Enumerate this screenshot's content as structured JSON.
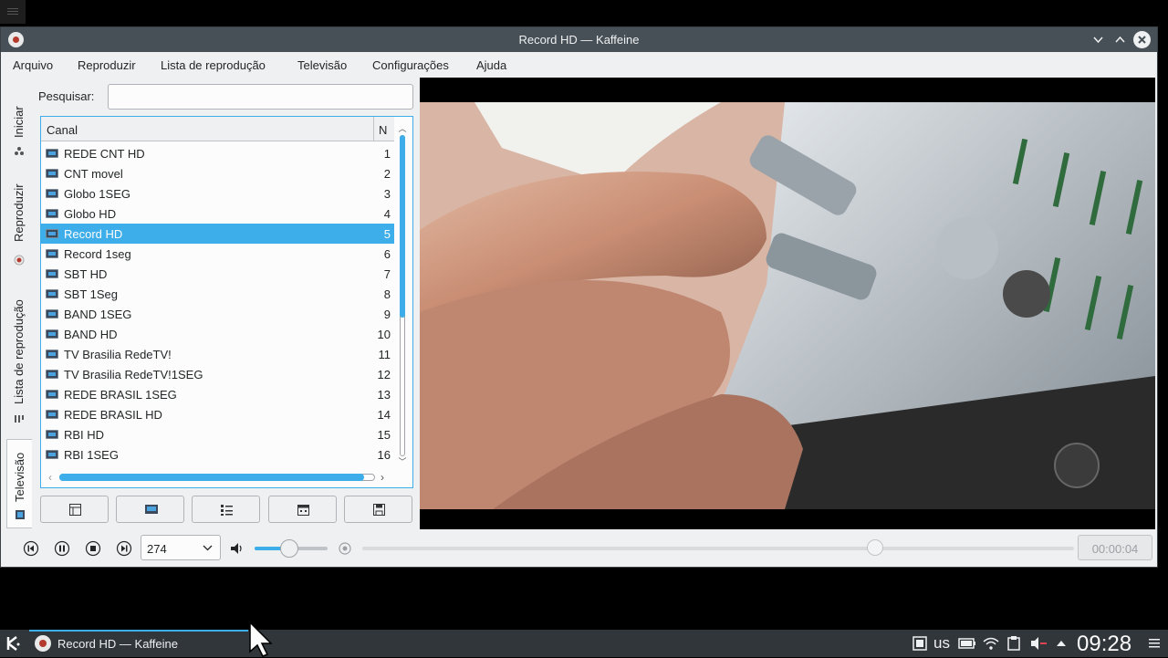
{
  "window": {
    "title": "Record HD — Kaffeine"
  },
  "menu": [
    "Arquivo",
    "Reproduzir",
    "Lista de reprodução",
    "Televisão",
    "Configurações",
    "Ajuda"
  ],
  "side_tabs": [
    "Iniciar",
    "Reproduzir",
    "Lista de reprodução",
    "Televisão"
  ],
  "search": {
    "label": "Pesquisar:",
    "value": ""
  },
  "channel_list": {
    "header_channel": "Canal",
    "header_number": "N",
    "rows": [
      {
        "name": "REDE CNT HD",
        "number": "1"
      },
      {
        "name": "CNT movel",
        "number": "2"
      },
      {
        "name": "Globo 1SEG",
        "number": "3"
      },
      {
        "name": "Globo HD",
        "number": "4"
      },
      {
        "name": "Record HD",
        "number": "5"
      },
      {
        "name": "Record 1seg",
        "number": "6"
      },
      {
        "name": "SBT HD",
        "number": "7"
      },
      {
        "name": "SBT 1Seg",
        "number": "8"
      },
      {
        "name": "BAND 1SEG",
        "number": "9"
      },
      {
        "name": "BAND HD",
        "number": "10"
      },
      {
        "name": "TV Brasilia RedeTV!",
        "number": "11"
      },
      {
        "name": "TV Brasilia RedeTV!1SEG",
        "number": "12"
      },
      {
        "name": "REDE BRASIL 1SEG",
        "number": "13"
      },
      {
        "name": "REDE BRASIL HD",
        "number": "14"
      },
      {
        "name": "RBI HD",
        "number": "15"
      },
      {
        "name": "RBI 1SEG",
        "number": "16"
      }
    ],
    "selected_index": 4
  },
  "transport": {
    "channel_value": "274",
    "volume_level": 0.47,
    "seek_position": 0.72,
    "time": "00:00:04"
  },
  "taskbar": {
    "task_label": "Record HD — Kaffeine",
    "keyboard_layout": "us",
    "clock": "09:28"
  },
  "colors": {
    "accent": "#3daee9",
    "titlebar": "#475057",
    "window_bg": "#eff0f1",
    "taskbar": "#31363b"
  }
}
